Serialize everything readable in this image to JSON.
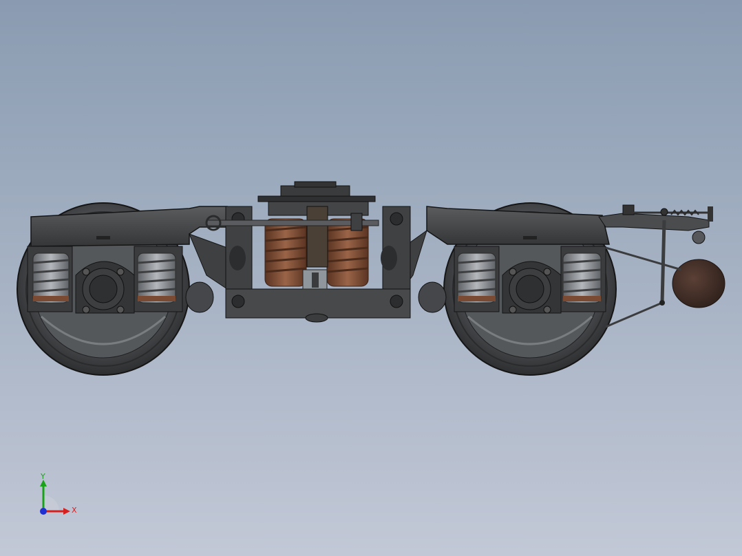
{
  "view": {
    "background_top": "#8a9bb1",
    "background_bottom": "#c2c8d6"
  },
  "model": {
    "subject": "railway-bogie",
    "frame_color": "#3d3f41",
    "spring_color": "#7a4a32",
    "steel_spring_color": "#8c8f93",
    "brake_shoe_color": "#3b2a24"
  },
  "triad": {
    "x_label": "X",
    "y_label": "Y",
    "x_color": "#d62020",
    "y_color": "#1aa31a",
    "z_color": "#2030d0"
  }
}
